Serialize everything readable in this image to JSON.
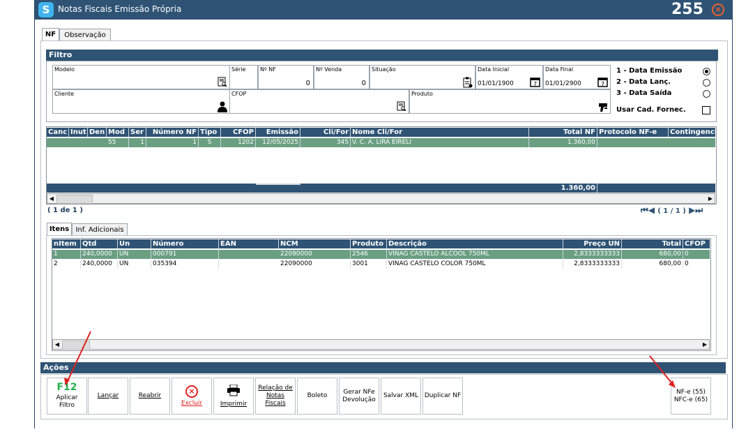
{
  "titlebar": {
    "logo": "S",
    "title": "Notas Fiscais Emissão Própria",
    "number": "255",
    "close_icon": "×"
  },
  "tabs": {
    "nf": "NF",
    "observacao": "Observação"
  },
  "filtro": {
    "header": "Filtro",
    "modelo_label": "Modelo",
    "serie_label": "Série",
    "nf_label": "Nº NF",
    "nf_value": "0",
    "venda_label": "Nº Venda",
    "venda_value": "0",
    "situacao_label": "Situação",
    "data_inicial_label": "Data Inicial",
    "data_inicial_value": "01/01/1900",
    "data_final_label": "Data Final",
    "data_final_value": "01/01/2900",
    "cliente_label": "Cliente",
    "cfop_label": "CFOP",
    "produto_label": "Produto",
    "opt1": "1 - Data Emissão",
    "opt2": "2 - Data Lanç.",
    "opt3": "3 - Data Saída",
    "usar_cad": "Usar Cad. Fornec.",
    "selected_option": "1 - Data Emissão"
  },
  "nf_grid": {
    "headers": [
      "Canc",
      "Inut",
      "Den",
      "Mod",
      "Ser",
      "Número NF",
      "Tipo",
      "CFOP",
      "Emissão",
      "Cli/For",
      "Nome Cli/For",
      "Total NF",
      "Protocolo NF-e",
      "Contingenci"
    ],
    "rows": [
      {
        "mod": "55",
        "ser": "1",
        "numero": "1",
        "tipo": "S",
        "cfop": "1202",
        "emissao": "12/05/2025",
        "clifor": "345",
        "nome": "V. C. A. LIRA EIRELI",
        "total": "1.360,00",
        "protocolo": ""
      }
    ],
    "footer_total": "1.360,00",
    "page_info": "( 1 de 1 )",
    "pager": "( 1 / 1 )"
  },
  "item_tabs": {
    "itens": "Itens",
    "inf": "Inf. Adicionais"
  },
  "items_grid": {
    "headers": [
      "nItem",
      "Qtd",
      "Un",
      "Número",
      "EAN",
      "NCM",
      "Produto",
      "Descrição",
      "Preço UN",
      "Total",
      "CFOP"
    ],
    "rows": [
      {
        "nitem": "1",
        "qtd": "240,0000",
        "un": "UN",
        "numero": "000791",
        "ean": "",
        "ncm": "22090000",
        "produto": "2546",
        "descricao": "VINAG CASTELO ALCOOL 750ML",
        "preco": "2,8333333333",
        "total": "680,00",
        "cfop": "0"
      },
      {
        "nitem": "2",
        "qtd": "240,0000",
        "un": "UN",
        "numero": "035394",
        "ean": "",
        "ncm": "22090000",
        "produto": "3001",
        "descricao": "VINAG CASTELO COLOR 750ML",
        "preco": "2,8333333333",
        "total": "680,00",
        "cfop": "0"
      }
    ]
  },
  "acoes": {
    "header": "Ações",
    "f12": "F12",
    "aplicar_line1": "Aplicar",
    "aplicar_line2": "Filtro",
    "lancar": "Lançar",
    "reabrir": "Reabrir",
    "excluir": "Excluir",
    "imprimir": "Imprimir",
    "relacao": "Relação de Notas Fiscais",
    "boleto": "Boleto",
    "gerar": "Gerar NFe Devolução",
    "salvar": "Salvar XML",
    "duplicar": "Duplicar NF",
    "nfe55": "NF-e (55)",
    "nfce65": "NFC-e (65)"
  },
  "colors": {
    "header_bg": "#2f5374",
    "selected_row": "#6a9f82",
    "accent_red": "#e02020",
    "logo": "#3fb4ee"
  }
}
